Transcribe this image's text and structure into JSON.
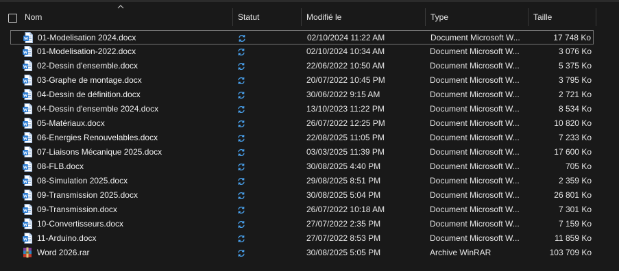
{
  "columns": {
    "name": "Nom",
    "status": "Statut",
    "modified": "Modifié le",
    "type": "Type",
    "size": "Taille"
  },
  "colors": {
    "background": "#191919",
    "word_blue": "#2b7cd3",
    "sync_blue": "#4aa3f0",
    "winrar_red": "#c0392b"
  },
  "files": [
    {
      "name": "01-Modelisation 2024.docx",
      "modified": "02/10/2024 11:22 AM",
      "type": "Document Microsoft W...",
      "size": "17 748 Ko",
      "icon": "word-doc-icon",
      "selected": true
    },
    {
      "name": "01-Modelisation-2022.docx",
      "modified": "02/10/2024 10:34 AM",
      "type": "Document Microsoft W...",
      "size": "3 076 Ko",
      "icon": "word-doc-icon"
    },
    {
      "name": "02-Dessin d'ensemble.docx",
      "modified": "22/06/2022 10:50 AM",
      "type": "Document Microsoft W...",
      "size": "5 375 Ko",
      "icon": "word-doc-icon"
    },
    {
      "name": "03-Graphe de montage.docx",
      "modified": "20/07/2022 10:45 PM",
      "type": "Document Microsoft W...",
      "size": "3 795 Ko",
      "icon": "word-doc-icon"
    },
    {
      "name": "04-Dessin de définition.docx",
      "modified": "30/06/2022 9:15 AM",
      "type": "Document Microsoft W...",
      "size": "2 721 Ko",
      "icon": "word-doc-icon"
    },
    {
      "name": "04-Dessin d'ensemble 2024.docx",
      "modified": "13/10/2023 11:22 PM",
      "type": "Document Microsoft W...",
      "size": "8 534 Ko",
      "icon": "word-doc-icon"
    },
    {
      "name": "05-Matériaux.docx",
      "modified": "26/07/2022 12:25 PM",
      "type": "Document Microsoft W...",
      "size": "10 820 Ko",
      "icon": "word-doc-icon"
    },
    {
      "name": "06-Energies Renouvelables.docx",
      "modified": "22/08/2025 11:05 PM",
      "type": "Document Microsoft W...",
      "size": "7 233 Ko",
      "icon": "word-doc-icon"
    },
    {
      "name": "07-Liaisons Mécanique 2025.docx",
      "modified": "03/03/2025 11:39 PM",
      "type": "Document Microsoft W...",
      "size": "17 600 Ko",
      "icon": "word-doc-icon"
    },
    {
      "name": "08-FLB.docx",
      "modified": "30/08/2025 4:40 PM",
      "type": "Document Microsoft W...",
      "size": "705 Ko",
      "icon": "word-doc-icon"
    },
    {
      "name": "08-Simulation 2025.docx",
      "modified": "29/08/2025 8:51 PM",
      "type": "Document Microsoft W...",
      "size": "2 359 Ko",
      "icon": "word-doc-icon"
    },
    {
      "name": "09-Transmission 2025.docx",
      "modified": "30/08/2025 5:04 PM",
      "type": "Document Microsoft W...",
      "size": "26 801 Ko",
      "icon": "word-doc-icon"
    },
    {
      "name": "09-Transmission.docx",
      "modified": "26/07/2022 10:18 AM",
      "type": "Document Microsoft W...",
      "size": "7 301 Ko",
      "icon": "word-doc-icon"
    },
    {
      "name": "10-Convertisseurs.docx",
      "modified": "27/07/2022 2:35 PM",
      "type": "Document Microsoft W...",
      "size": "7 159 Ko",
      "icon": "word-doc-icon"
    },
    {
      "name": "11-Arduino.docx",
      "modified": "27/07/2022 8:53 PM",
      "type": "Document Microsoft W...",
      "size": "11 859 Ko",
      "icon": "word-doc-icon"
    },
    {
      "name": "Word 2026.rar",
      "modified": "30/08/2025 5:05 PM",
      "type": "Archive WinRAR",
      "size": "103 709 Ko",
      "icon": "winrar-archive-icon"
    }
  ]
}
